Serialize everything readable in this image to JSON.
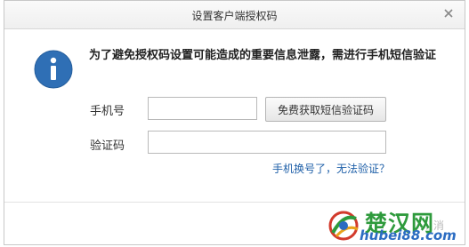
{
  "dialog": {
    "title": "设置客户端授权码",
    "close_icon": "close-icon",
    "info_icon": "info-icon",
    "message": "为了避免授权码设置可能造成的重要信息泄露，需进行手机短信验证",
    "phone_label": "手机号",
    "phone_value": "",
    "sms_button_label": "免费获取短信验证码",
    "code_label": "验证码",
    "code_value": "",
    "cannot_verify_link": "手机换号了，无法验证？",
    "footer_partial_text": "取消"
  },
  "watermark": {
    "text": "楚汉网",
    "url": "hubei88.com"
  },
  "colors": {
    "info_icon_bg": "#2f6fb5",
    "link": "#1e5fa8",
    "watermark_green": "#2e9a3c",
    "watermark_blue": "#2b6cc2"
  }
}
